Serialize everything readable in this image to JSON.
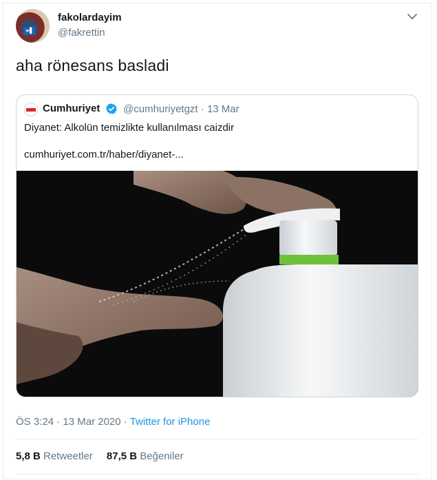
{
  "author": {
    "display_name": "fakolardayim",
    "handle": "@fakrettin"
  },
  "tweet": {
    "text": "aha rönesans basladi"
  },
  "quoted": {
    "name": "Cumhuriyet",
    "handle": "@cumhuriyetgzt",
    "separator": "·",
    "date": "13 Mar",
    "text": "Diyanet: Alkolün temizlikte kullanılması caizdir",
    "link": "cumhuriyet.com.tr/haber/diyanet-..."
  },
  "meta": {
    "time": "ÖS 3:24",
    "separator": "·",
    "date": "13 Mar 2020",
    "source": "Twitter for iPhone"
  },
  "stats": {
    "retweets_count": "5,8 B",
    "retweets_label": "Retweetler",
    "likes_count": "87,5 B",
    "likes_label": "Beğeniler"
  },
  "colors": {
    "link_blue": "#1b95e0",
    "verified_blue": "#1da1f2",
    "muted_gray": "#657786",
    "border": "#e6ecf0"
  },
  "icons": {
    "more": "chevron-down-icon",
    "verified": "verified-badge-icon"
  }
}
